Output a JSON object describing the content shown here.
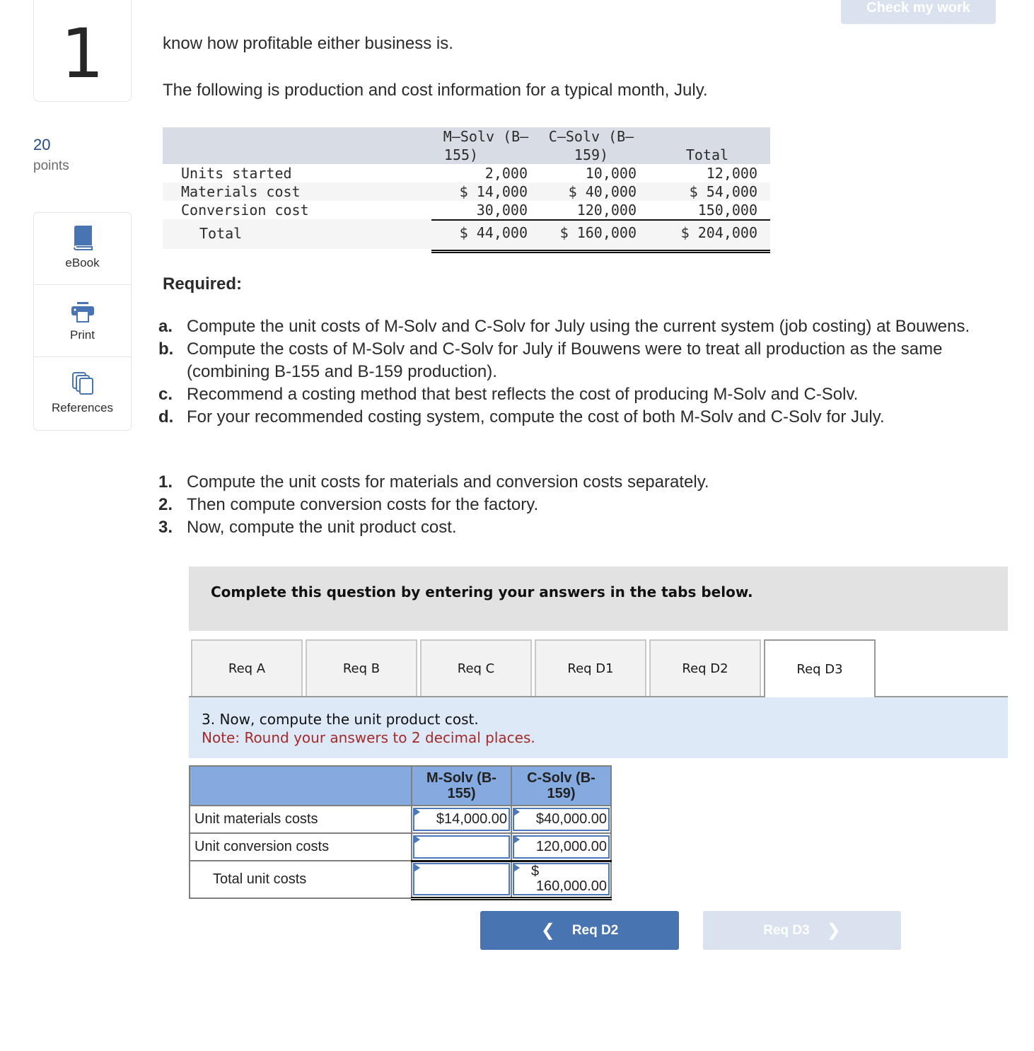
{
  "question": {
    "number": "1",
    "points_value": "20",
    "points_label": "points"
  },
  "tools": [
    {
      "label": "eBook",
      "icon": "book-icon"
    },
    {
      "label": "Print",
      "icon": "printer-icon"
    },
    {
      "label": "References",
      "icon": "documents-icon"
    }
  ],
  "check_button": "Check my work",
  "intro_line1": "know how profitable either business is.",
  "intro_line2": "The following is production and cost information for a typical month, July.",
  "data_table": {
    "headers": [
      "M–Solv (B–",
      "155)",
      "C–Solv (B–",
      "159)",
      "Total"
    ],
    "rows": [
      {
        "label": "Units started",
        "values": [
          "2,000",
          "10,000",
          "12,000"
        ]
      },
      {
        "label": "Materials cost",
        "values": [
          "$ 14,000",
          "$ 40,000",
          "$ 54,000"
        ]
      },
      {
        "label": "Conversion cost",
        "values": [
          "30,000",
          "120,000",
          "150,000"
        ]
      },
      {
        "label": "Total",
        "values": [
          "$ 44,000",
          "$ 160,000",
          "$ 204,000"
        ]
      }
    ]
  },
  "required_heading": "Required:",
  "requirements": [
    {
      "marker": "a.",
      "text": "Compute the unit costs of M-Solv and C-Solv for July using the current system (job costing) at Bouwens."
    },
    {
      "marker": "b.",
      "text": "Compute the costs of M-Solv and C-Solv for July if Bouwens were to treat all production as the same (combining B-155 and B-159 production)."
    },
    {
      "marker": "c.",
      "text": "Recommend a costing method that best reflects the cost of producing M-Solv and C-Solv."
    },
    {
      "marker": "d.",
      "text": "For your recommended costing system, compute the cost of both M-Solv and C-Solv for July."
    }
  ],
  "steps": [
    {
      "marker": "1.",
      "text": "Compute the unit costs for materials and conversion costs separately."
    },
    {
      "marker": "2.",
      "text": "Then compute conversion costs for the factory."
    },
    {
      "marker": "3.",
      "text": "Now, compute the unit product cost."
    }
  ],
  "instructions": "Complete this question by entering your answers in the tabs below.",
  "tabs": [
    {
      "label": "Req A",
      "active": false
    },
    {
      "label": "Req B",
      "active": false
    },
    {
      "label": "Req C",
      "active": false
    },
    {
      "label": "Req D1",
      "active": false
    },
    {
      "label": "Req D2",
      "active": false
    },
    {
      "label": "Req D3",
      "active": true
    }
  ],
  "panel": {
    "question": "3. Now, compute the unit product cost.",
    "note": "Note: Round your answers to 2 decimal places."
  },
  "answer_table": {
    "headers": [
      "",
      "M-Solv (B-155)",
      "C-Solv (B-159)"
    ],
    "header_lines": {
      "m1": "M-Solv (B-",
      "m2": "155)",
      "c1": "C-Solv (B-",
      "c2": "159)"
    },
    "rows": [
      {
        "label": "Unit materials costs",
        "m_solv": {
          "currency": "$",
          "value": "14,000.00"
        },
        "c_solv": {
          "currency": "$",
          "value": "40,000.00"
        }
      },
      {
        "label": "Unit conversion costs",
        "m_solv": {
          "currency": "",
          "value": ""
        },
        "c_solv": {
          "currency": "",
          "value": "120,000.00"
        }
      },
      {
        "label": "Total unit costs",
        "m_solv": {
          "currency": "",
          "value": ""
        },
        "c_solv": {
          "currency": "$",
          "value": "160,000.00"
        }
      }
    ]
  },
  "nav": {
    "prev_label": "Req D2",
    "next_label": "Req D3",
    "prev_icon": "chevron-left-icon",
    "next_icon": "chevron-right-icon"
  },
  "colors": {
    "accent": "#4874b1",
    "disabled": "#d9e2ee",
    "note_red": "#a52a2a",
    "header_blue": "#84aadf",
    "panel_bg": "#dde9f7"
  }
}
